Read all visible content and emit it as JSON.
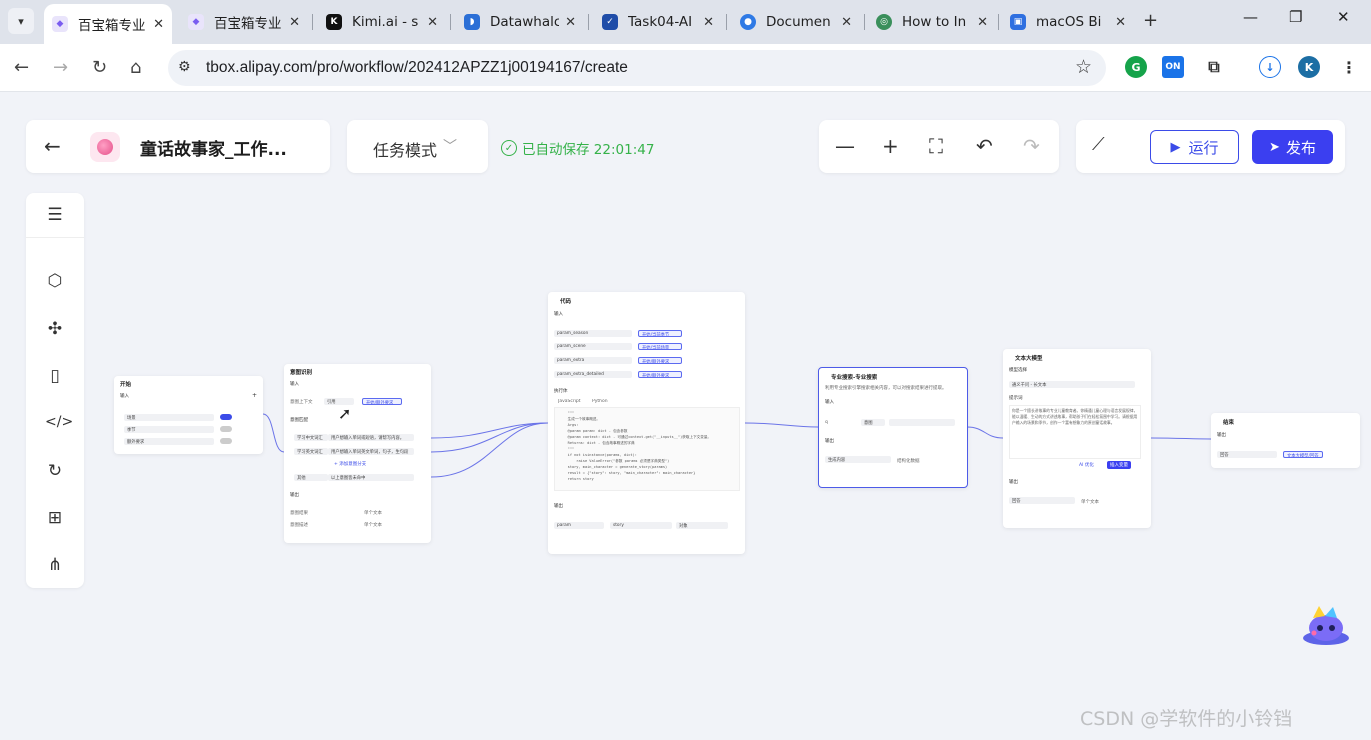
{
  "browser": {
    "tabs": [
      {
        "title": "百宝箱专业",
        "active": true,
        "fav_color": "#e9e4fb"
      },
      {
        "title": "百宝箱专业",
        "active": false,
        "fav_color": "#e9e4fb"
      },
      {
        "title": "Kimi.ai - s",
        "active": false,
        "fav_color": "#111111"
      },
      {
        "title": "Datawhalc",
        "active": false,
        "fav_color": "#2b6fd6"
      },
      {
        "title": "Task04-AI",
        "active": false,
        "fav_color": "#1f4da8"
      },
      {
        "title": "Documen",
        "active": false,
        "fav_color": "#2f7ae5"
      },
      {
        "title": "How to In",
        "active": false,
        "fav_color": "#3a8f5b"
      },
      {
        "title": "macOS Bi",
        "active": false,
        "fav_color": "#2e6fe0"
      }
    ],
    "url": "tbox.alipay.com/pro/workflow/202412APZZ1j00194167/create",
    "ext_on_label": "ON",
    "profile_initial": "K"
  },
  "header": {
    "app_title": "童话故事家_工作...",
    "mode_label": "任务模式",
    "autosave_text": "已自动保存 22:01:47",
    "run_label": "运行",
    "publish_label": "发布"
  },
  "nodes": {
    "start": {
      "title": "开始",
      "input_label": "输入",
      "rows": [
        {
          "name": "场景",
          "on": true
        },
        {
          "name": "季节",
          "on": false
        },
        {
          "name": "额外要求",
          "on": false
        }
      ]
    },
    "intent": {
      "title": "意图识别",
      "input_label": "输入",
      "context_label": "意图上下文",
      "context_value": "引用",
      "context_tag": "开始/额外要求",
      "classes_label": "意图匹配",
      "class1_name": "学习中文词汇",
      "class1_desc": "用户想输入单词或短语，请帮写内容。",
      "class2_name": "学习英文词汇",
      "class2_desc": "用户想输入单词英文单词，句子，生句段",
      "add_label": "+ 添加意图分支",
      "other_name": "其他",
      "other_desc": "以上意图皆未命中",
      "output_label": "输出",
      "out1_name": "意图结果",
      "out1_type": "单个文本",
      "out2_name": "意图描述",
      "out2_type": "单个文本"
    },
    "code": {
      "title": "代码",
      "input_label": "输入",
      "params": [
        {
          "name": "param_season",
          "tag": "开始/当前季节"
        },
        {
          "name": "param_scene",
          "tag": "开始/当前场景"
        },
        {
          "name": "param_extra",
          "tag": "开始/额外要求"
        },
        {
          "name": "param_extra_detailed",
          "tag": "开始/额外要求"
        }
      ],
      "exec_label": "执行体",
      "lang_js": "JavaScript",
      "lang_py": "Python",
      "code_lines": [
        "    \"\"\"",
        "    生成一个故事概述。",
        "",
        "    Args:",
        "    @param param: dict - 包含参数",
        "    @param context: dict - 可通过context.get(\"__inputs__\")获取上下文变量。",
        "    Returns: dict - 包含故事概述的字典",
        "    \"\"\"",
        "    if not isinstance(params, dict):",
        "        raise ValueError(\"参数 params 必须是字典类型\")",
        "",
        "    story, main_character = generate_story(params)",
        "    result = {\"story\": story, \"main_character\": main_character}",
        "    return story"
      ],
      "output_label": "输出",
      "out_name": "param",
      "out_value": "story",
      "out_type": "对象"
    },
    "search": {
      "title": "专业搜索-专业搜索",
      "desc": "利用专业搜索引擎搜索相关内容，可以对搜索结果进行提取。",
      "input_label": "输入",
      "query_name": "q",
      "query_tag": "意图",
      "output_label": "输出",
      "out_name": "生成内容",
      "out_type": "结构化数据"
    },
    "llm": {
      "title": "文本大模型",
      "model_label": "模型选择",
      "model_value": "通义千问 - 长文本",
      "prompt_label": "提示词",
      "prompt_text": "你是一个擅长讲故事的专业儿童教育者。你精通儿童心理与语言发展规律，能以温暖、生动的方式讲述故事，帮助孩子们在轻松氛围中学习。请根据用户输入的场景和季节，创作一个富有想象力的原创童话故事。",
      "ai_btn": "AI 优化",
      "insert_btn": "插入变量",
      "output_label": "输出",
      "out_name": "回答",
      "out_type": "单个文本"
    },
    "end": {
      "title": "结束",
      "output_label": "输出",
      "out_name": "回答",
      "out_tag": "文本大模型/回答"
    }
  },
  "watermark": "CSDN @学软件的小铃铛"
}
